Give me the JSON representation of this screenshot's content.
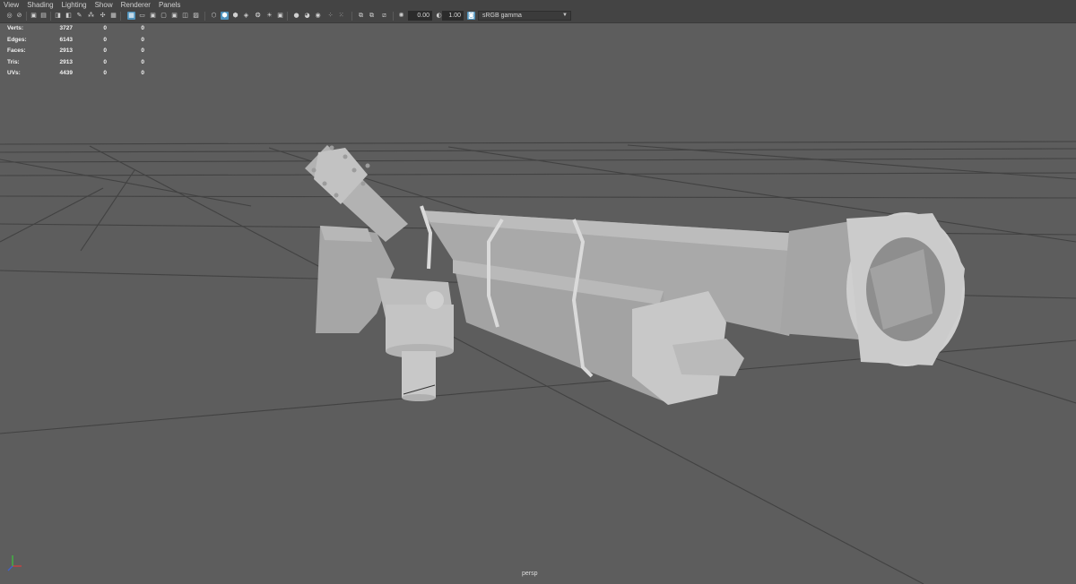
{
  "menu": [
    "View",
    "Shading",
    "Lighting",
    "Show",
    "Renderer",
    "Panels"
  ],
  "toolbar": {
    "exposure_value": "0.00",
    "gamma_value": "1.00",
    "color_space": "sRGB gamma"
  },
  "hud": {
    "rows": [
      {
        "label": "Verts:",
        "values": [
          "3727",
          "0",
          "0"
        ]
      },
      {
        "label": "Edges:",
        "values": [
          "6143",
          "0",
          "0"
        ]
      },
      {
        "label": "Faces:",
        "values": [
          "2913",
          "0",
          "0"
        ]
      },
      {
        "label": "Tris:",
        "values": [
          "2913",
          "0",
          "0"
        ]
      },
      {
        "label": "UVs:",
        "values": [
          "4439",
          "0",
          "0"
        ]
      }
    ]
  },
  "camera_label": "persp",
  "colors": {
    "background": "#5d5d5d",
    "toolbar": "#444444",
    "accent": "#4f93bd",
    "grid": "#3f3f3f",
    "model": "#bdbdbd"
  },
  "icons": [
    "camera-select-icon",
    "lock-camera-icon",
    "bookmark-icon",
    "image-plane-icon",
    "grid-icon",
    "film-gate-icon",
    "resolution-gate-icon",
    "gate-mask-icon",
    "wireframe-icon",
    "smooth-shade-icon",
    "textured-icon",
    "use-lights-icon",
    "shadows-icon",
    "ambient-occlusion-icon",
    "motion-blur-icon",
    "anti-aliasing-icon",
    "depth-of-field-icon",
    "isolate-select-icon",
    "xray-icon",
    "xray-joints-icon",
    "xray-components-icon",
    "exposure-icon",
    "gamma-icon",
    "color-management-icon"
  ]
}
